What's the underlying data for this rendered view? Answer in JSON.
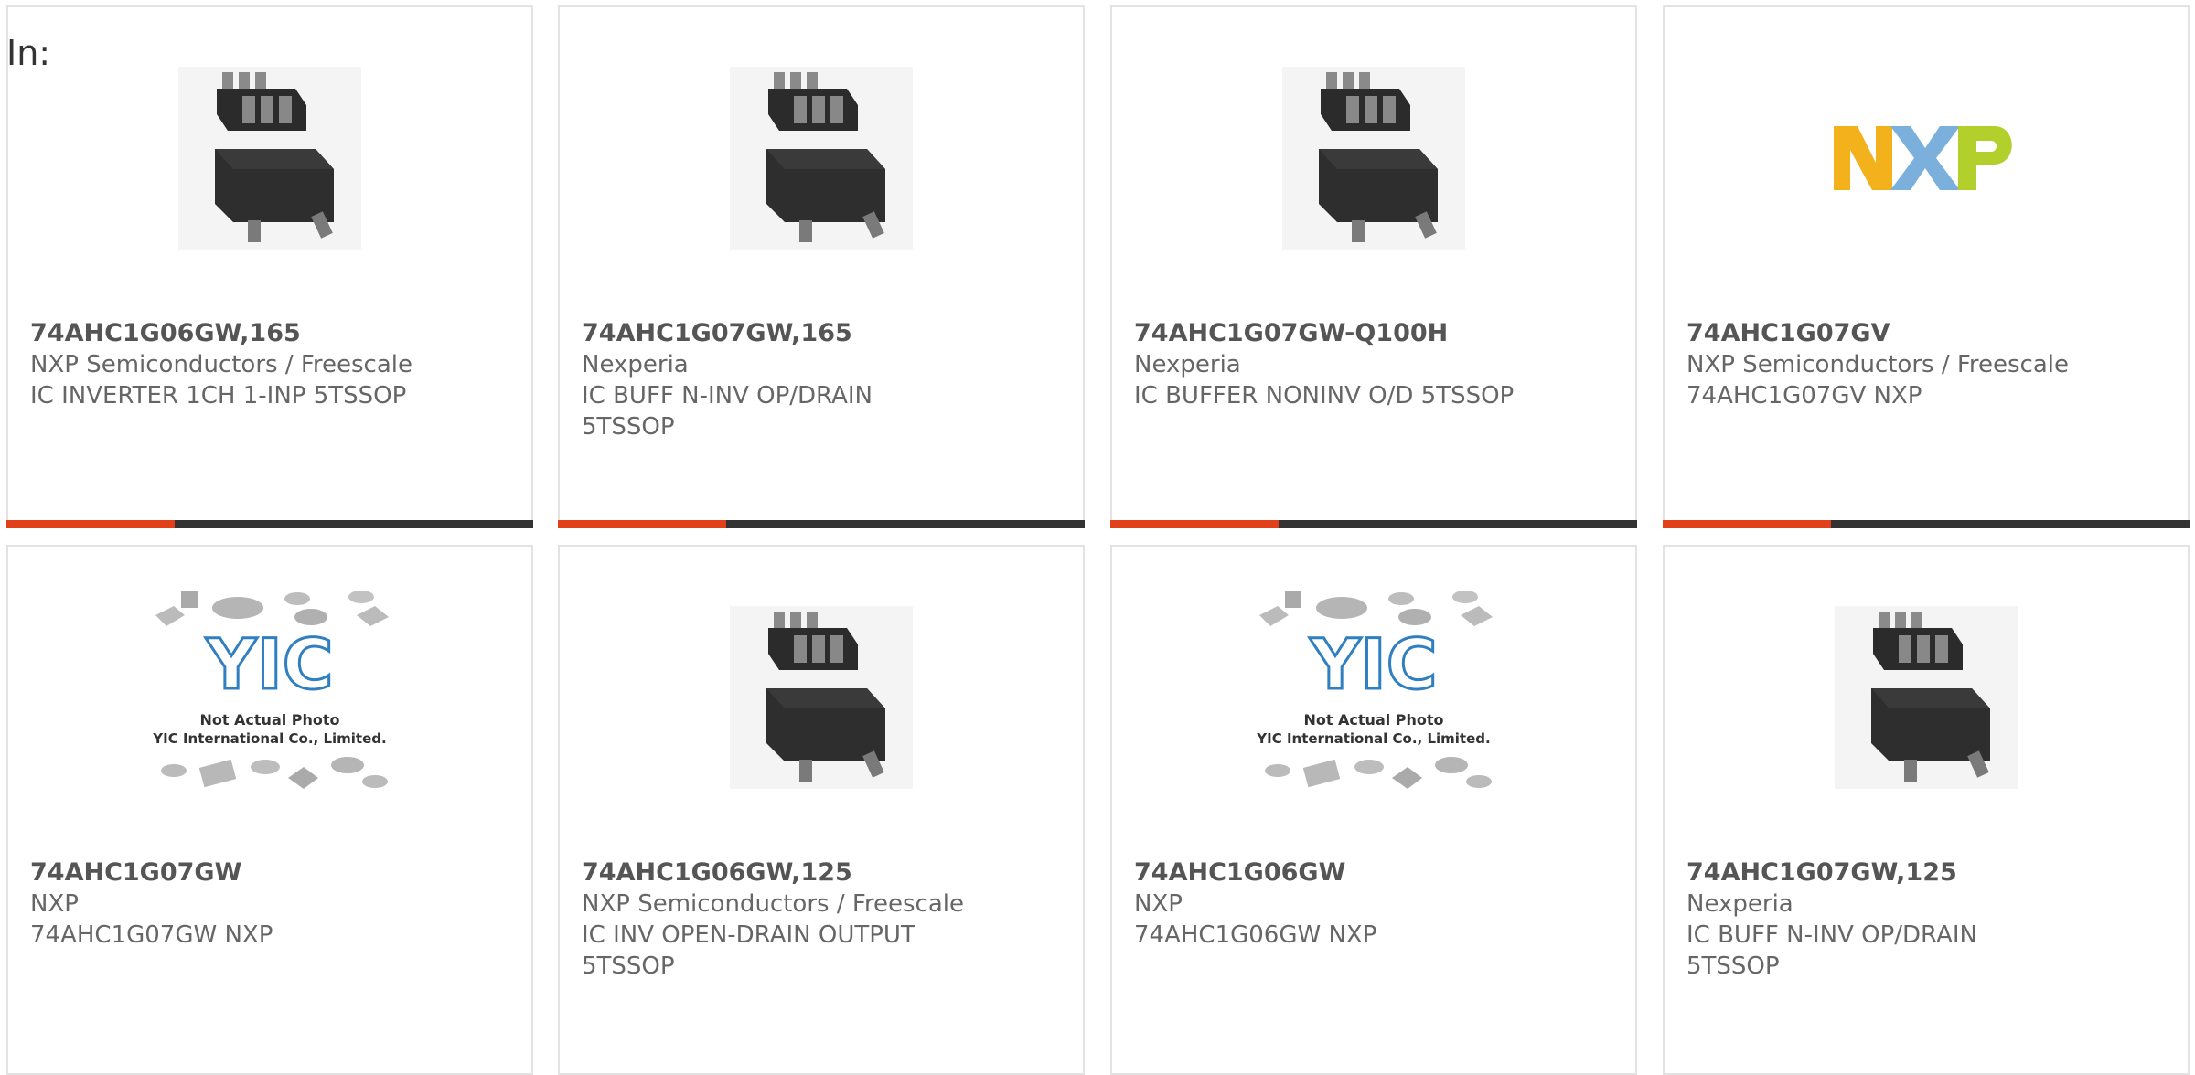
{
  "page": {
    "heading": "In:"
  },
  "colors": {
    "accent": "#e0401a",
    "bar": "#333333",
    "border": "#e3e3e3"
  },
  "products": [
    {
      "part": "74AHC1G06GW,165",
      "mfr": "NXP Semiconductors / Freescale",
      "desc": "IC INVERTER 1CH 1-INP 5TSSOP",
      "image": "chip-photo"
    },
    {
      "part": "74AHC1G07GW,165",
      "mfr": "Nexperia",
      "desc": "IC BUFF N-INV OP/DRAIN 5TSSOP",
      "image": "chip-photo"
    },
    {
      "part": "74AHC1G07GW-Q100H",
      "mfr": "Nexperia",
      "desc": "IC BUFFER NONINV O/D 5TSSOP",
      "image": "chip-photo"
    },
    {
      "part": "74AHC1G07GV",
      "mfr": "NXP Semiconductors / Freescale",
      "desc": "74AHC1G07GV NXP",
      "image": "nxp-logo",
      "logo_text": "NXP"
    },
    {
      "part": "74AHC1G07GW",
      "mfr": "NXP",
      "desc": "74AHC1G07GW NXP",
      "image": "yic-placeholder",
      "placeholder_line1": "Not Actual Photo",
      "placeholder_line2": "YIC International Co., Limited."
    },
    {
      "part": "74AHC1G06GW,125",
      "mfr": "NXP Semiconductors / Freescale",
      "desc": "IC INV OPEN-DRAIN OUTPUT 5TSSOP",
      "image": "chip-photo"
    },
    {
      "part": "74AHC1G06GW",
      "mfr": "NXP",
      "desc": "74AHC1G06GW NXP",
      "image": "yic-placeholder",
      "placeholder_line1": "Not Actual Photo",
      "placeholder_line2": "YIC International Co., Limited."
    },
    {
      "part": "74AHC1G07GW,125",
      "mfr": "Nexperia",
      "desc": "IC BUFF N-INV OP/DRAIN 5TSSOP",
      "image": "chip-photo"
    }
  ]
}
